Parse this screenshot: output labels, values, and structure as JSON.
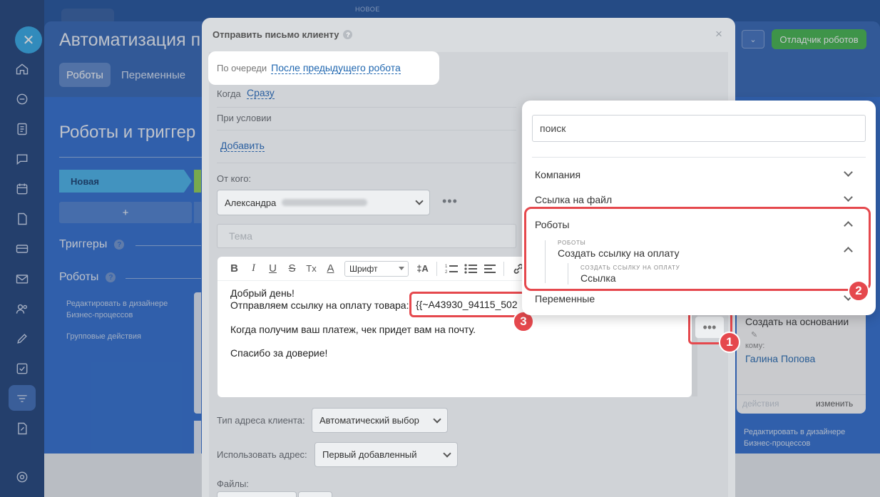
{
  "background": {
    "top_badge": "НОВОЕ",
    "page_title": "Автоматизация п",
    "tabs": [
      "Роботы",
      "Переменные"
    ],
    "section_title": "Роботы и триггер",
    "stage_label": "Новая",
    "add_label": "+",
    "triggers_label": "Триггеры",
    "robots_label": "Роботы",
    "help_mark": "?",
    "sidebar_links": [
      "Редактировать в дизайнере Бизнес-процессов",
      "Групповые действия"
    ],
    "debug_button": "Отладчик роботов",
    "right_card": {
      "title": "Создать на основании",
      "to_label": "кому:",
      "to_value": "Галина Попова",
      "actions": "действия",
      "edit": "изменить",
      "below_link": "Редактировать в дизайнере Бизнес-процессов"
    }
  },
  "modal": {
    "title": "Отправить письмо клиенту",
    "help_mark": "?",
    "close": "×",
    "queue_label": "По очереди",
    "queue_value": "После предыдущего робота",
    "when_label": "Когда",
    "when_value": "Сразу",
    "condition_label": "При условии",
    "add_link": "Добавить",
    "from_label": "От кого:",
    "from_value": "Александра",
    "more_dots": "•••",
    "subject_placeholder": "Тема",
    "toolbar": {
      "bold": "B",
      "italic": "I",
      "underline": "U",
      "strike": "S",
      "clear": "Tx",
      "color": "A",
      "font": "Шрифт",
      "size": "‡A"
    },
    "body": {
      "line1": "Добрый день!",
      "line2": "Отправляем ссылку на оплату товара:",
      "variable": "{{~A43930_94115_502",
      "line3": "Когда получим ваш платеж, чек придет вам на почту.",
      "line4": "Спасибо за доверие!"
    },
    "address_type_label": "Тип адреса клиента:",
    "address_type_value": "Автоматический выбор",
    "use_address_label": "Использовать адрес:",
    "use_address_value": "Первый добавленный",
    "files_label": "Файлы:",
    "insert_dots": "•••"
  },
  "popup": {
    "search_placeholder": "поиск",
    "items": [
      "Компания",
      "Ссылка на файл",
      "Роботы",
      "Переменные"
    ],
    "robots_caption": "РОБОТЫ",
    "robots_sub": "Создать ссылку на оплату",
    "link_caption": "СОЗДАТЬ ССЫЛКУ НА ОПЛАТУ",
    "link_item": "Ссылка"
  },
  "badges": [
    "1",
    "2",
    "3"
  ],
  "colors": {
    "accent_red": "#e5484d",
    "link_blue": "#2067b0",
    "green": "#3fb449"
  }
}
